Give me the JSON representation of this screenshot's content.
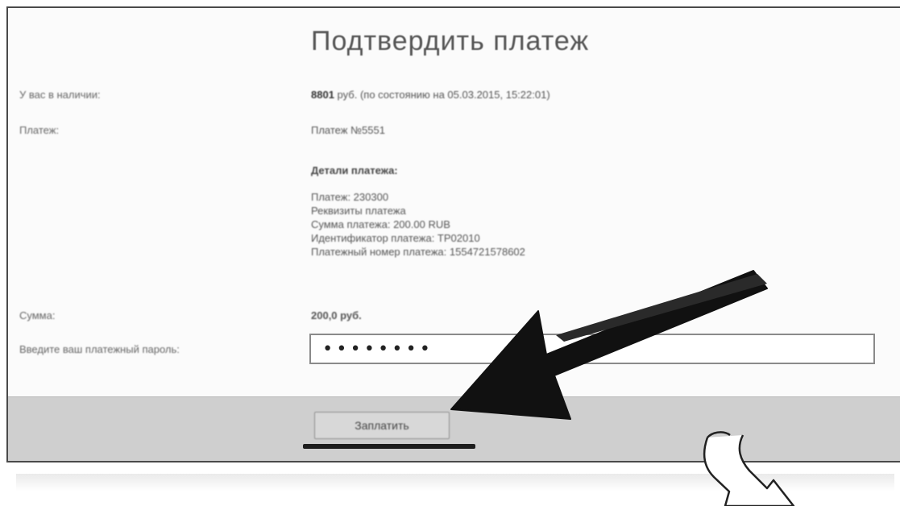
{
  "form": {
    "title": "Подтвердить платеж",
    "rows": {
      "balance_label": "У вас в наличии:",
      "balance_amount": "8801",
      "balance_rest": "руб. (по состоянию на 05.03.2015, 15:22:01)",
      "payee_label": "Платеж:",
      "payee_value": "Платеж №5551",
      "details_header": "Детали платежа:",
      "details": [
        "Платеж: 230300",
        "Реквизиты платежа",
        "Сумма платежа: 200.00 RUB",
        "Идентификатор платежа: TP02010",
        "Платежный номер платежа: 1554721578602"
      ],
      "amount_label": "Сумма:",
      "amount_value": "200,0 руб.",
      "password_label": "Введите ваш платежный пароль:",
      "password_value": "••••••••"
    },
    "pay_button_label": "Заплатить"
  },
  "annotations": {
    "arrow_color": "#111111",
    "underline_color": "#1d1d1d",
    "cursor_arrow_color": "#ffffff"
  }
}
